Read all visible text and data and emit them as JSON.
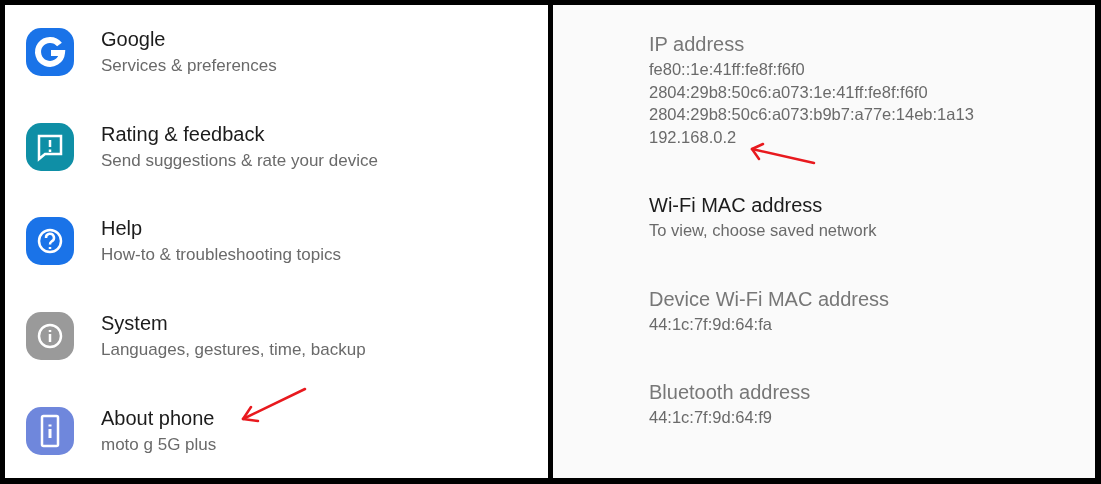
{
  "settings_list": [
    {
      "kind": "google",
      "color": "#1a73e8",
      "title": "Google",
      "subtitle": "Services & preferences"
    },
    {
      "kind": "feedback",
      "color": "#0f8fa6",
      "title": "Rating & feedback",
      "subtitle": "Send suggestions & rate your device"
    },
    {
      "kind": "help",
      "color": "#1a73e8",
      "title": "Help",
      "subtitle": "How-to & troubleshooting topics"
    },
    {
      "kind": "system",
      "color": "#9a9a9a",
      "title": "System",
      "subtitle": "Languages, gestures, time, backup"
    },
    {
      "kind": "phone",
      "color": "#6f87dc",
      "title": "About phone",
      "subtitle": "moto g 5G plus",
      "annotated": true
    }
  ],
  "network_details": [
    {
      "title": "IP address",
      "disabled": true,
      "values": [
        "fe80::1e:41ff:fe8f:f6f0",
        "2804:29b8:50c6:a073:1e:41ff:fe8f:f6f0",
        "2804:29b8:50c6:a073:b9b7:a77e:14eb:1a13",
        "192.168.0.2"
      ],
      "annotated": true
    },
    {
      "title": "Wi-Fi MAC address",
      "disabled": false,
      "values": [
        "To view, choose saved network"
      ]
    },
    {
      "title": "Device Wi-Fi MAC address",
      "disabled": true,
      "values": [
        "44:1c:7f:9d:64:fa"
      ]
    },
    {
      "title": "Bluetooth address",
      "disabled": true,
      "values": [
        "44:1c:7f:9d:64:f9"
      ]
    }
  ]
}
